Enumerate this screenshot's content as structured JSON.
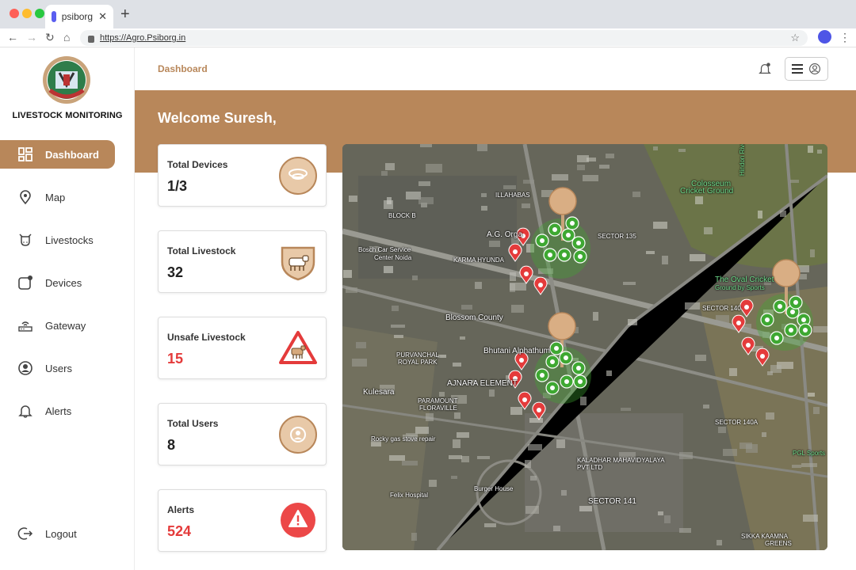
{
  "browser": {
    "tab_title": "psiborg",
    "tab_close": "✕",
    "new_tab": "+",
    "url": "https://Agro.Psiborg.in"
  },
  "sidebar": {
    "brand": "LIVESTOCK MONITORING",
    "items": [
      {
        "label": "Dashboard",
        "icon": "dashboard-icon",
        "active": true
      },
      {
        "label": "Map",
        "icon": "map-pin-icon"
      },
      {
        "label": "Livestocks",
        "icon": "cow-icon"
      },
      {
        "label": "Devices",
        "icon": "device-icon"
      },
      {
        "label": "Gateway",
        "icon": "gateway-icon"
      },
      {
        "label": "Users",
        "icon": "user-icon"
      },
      {
        "label": "Alerts",
        "icon": "bell-icon"
      }
    ],
    "logout": "Logout"
  },
  "header": {
    "title": "Dashboard"
  },
  "banner": {
    "welcome": "Welcome Suresh,"
  },
  "cards": [
    {
      "label": "Total Devices",
      "value": "1/3",
      "icon": "device-tag-icon"
    },
    {
      "label": "Total Livestock",
      "value": "32",
      "icon": "cow-badge-icon"
    },
    {
      "label": "Unsafe Livestock",
      "value": "15",
      "icon": "cow-warning-icon"
    },
    {
      "label": "Total Users",
      "value": "8",
      "icon": "users-icon"
    },
    {
      "label": "Alerts",
      "value": "524",
      "icon": "alert-icon"
    }
  ],
  "map": {
    "labels": [
      "ILLAHABAS",
      "BLOCK B",
      "A.G. Orga",
      "Bosch Car Service",
      "Center Noida",
      "KARMA HYUNDA",
      "SECTOR 135",
      "Colosseum",
      "Cricket Ground",
      "Hindon River",
      "The Oval Cricket",
      "Ground by Sports",
      "SECTOR 140",
      "Blossom County",
      "Bhutani Alphathum",
      "PURVANCHAL",
      "ROYAL PARK",
      "AJNARA ELEMENT",
      "Kulesara",
      "PARAMOUNT",
      "FLORAVILLE",
      "Rocky gas stove repair",
      "SECTOR 140A",
      "KALADHAR MAHAVIDYALAYA",
      "PVT LTD",
      "Felix Hospital",
      "Burger House",
      "SECTOR 141",
      "PGL Sports",
      "SIKKA KAAMNA",
      "GREENS"
    ]
  },
  "colors": {
    "accent": "#b8875a",
    "danger": "#e43b3b",
    "safe": "#3ea832"
  }
}
